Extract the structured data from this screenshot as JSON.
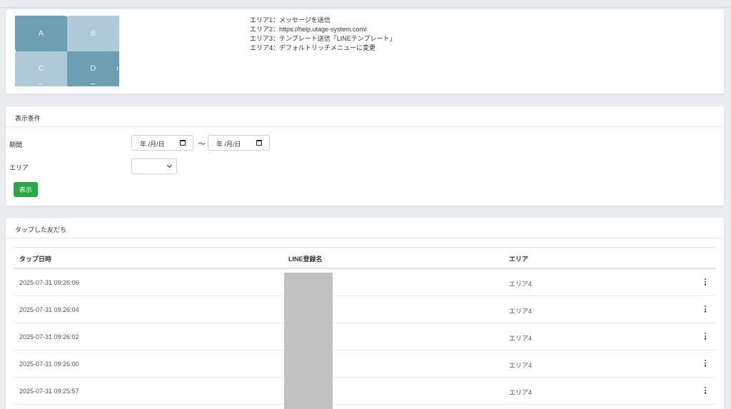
{
  "rich_menu": {
    "cells": [
      "A",
      "B",
      "C",
      "D"
    ],
    "areas": [
      "エリア1：メッセージを送信",
      "エリア2：https://help.utage-system.com/",
      "エリア3：テンプレート送信「LINEテンプレート」",
      "エリア4：デフォルトリッチメニューに変更"
    ]
  },
  "filter": {
    "title": "表示条件",
    "period_label": "期間",
    "date_from_placeholder": "年 /月/日",
    "date_separator": "〜",
    "date_to_placeholder": "年 /月/日",
    "area_label": "エリア",
    "area_selected": "",
    "submit_label": "表示"
  },
  "tapped": {
    "title": "タップした友だち",
    "columns": [
      "タップ日時",
      "LINE登録名",
      "エリア"
    ],
    "rows": [
      {
        "date": "2025-07-31 09:26:06",
        "name": "",
        "area": "エリア4"
      },
      {
        "date": "2025-07-31 09:26:04",
        "name": "",
        "area": "エリア4"
      },
      {
        "date": "2025-07-31 09:26:02",
        "name": "",
        "area": "エリア4"
      },
      {
        "date": "2025-07-31 09:26:00",
        "name": "",
        "area": "エリア4"
      },
      {
        "date": "2025-07-31 09:25:57",
        "name": "",
        "area": "エリア4"
      }
    ]
  },
  "colors": {
    "accent_green": "#28a745",
    "rich_dark": "#6c9fb2",
    "rich_light": "#aecad8",
    "redaction": "#c0c0c0"
  },
  "icons": [
    "calendar-icon",
    "chevron-down-icon",
    "more-vertical-icon"
  ]
}
